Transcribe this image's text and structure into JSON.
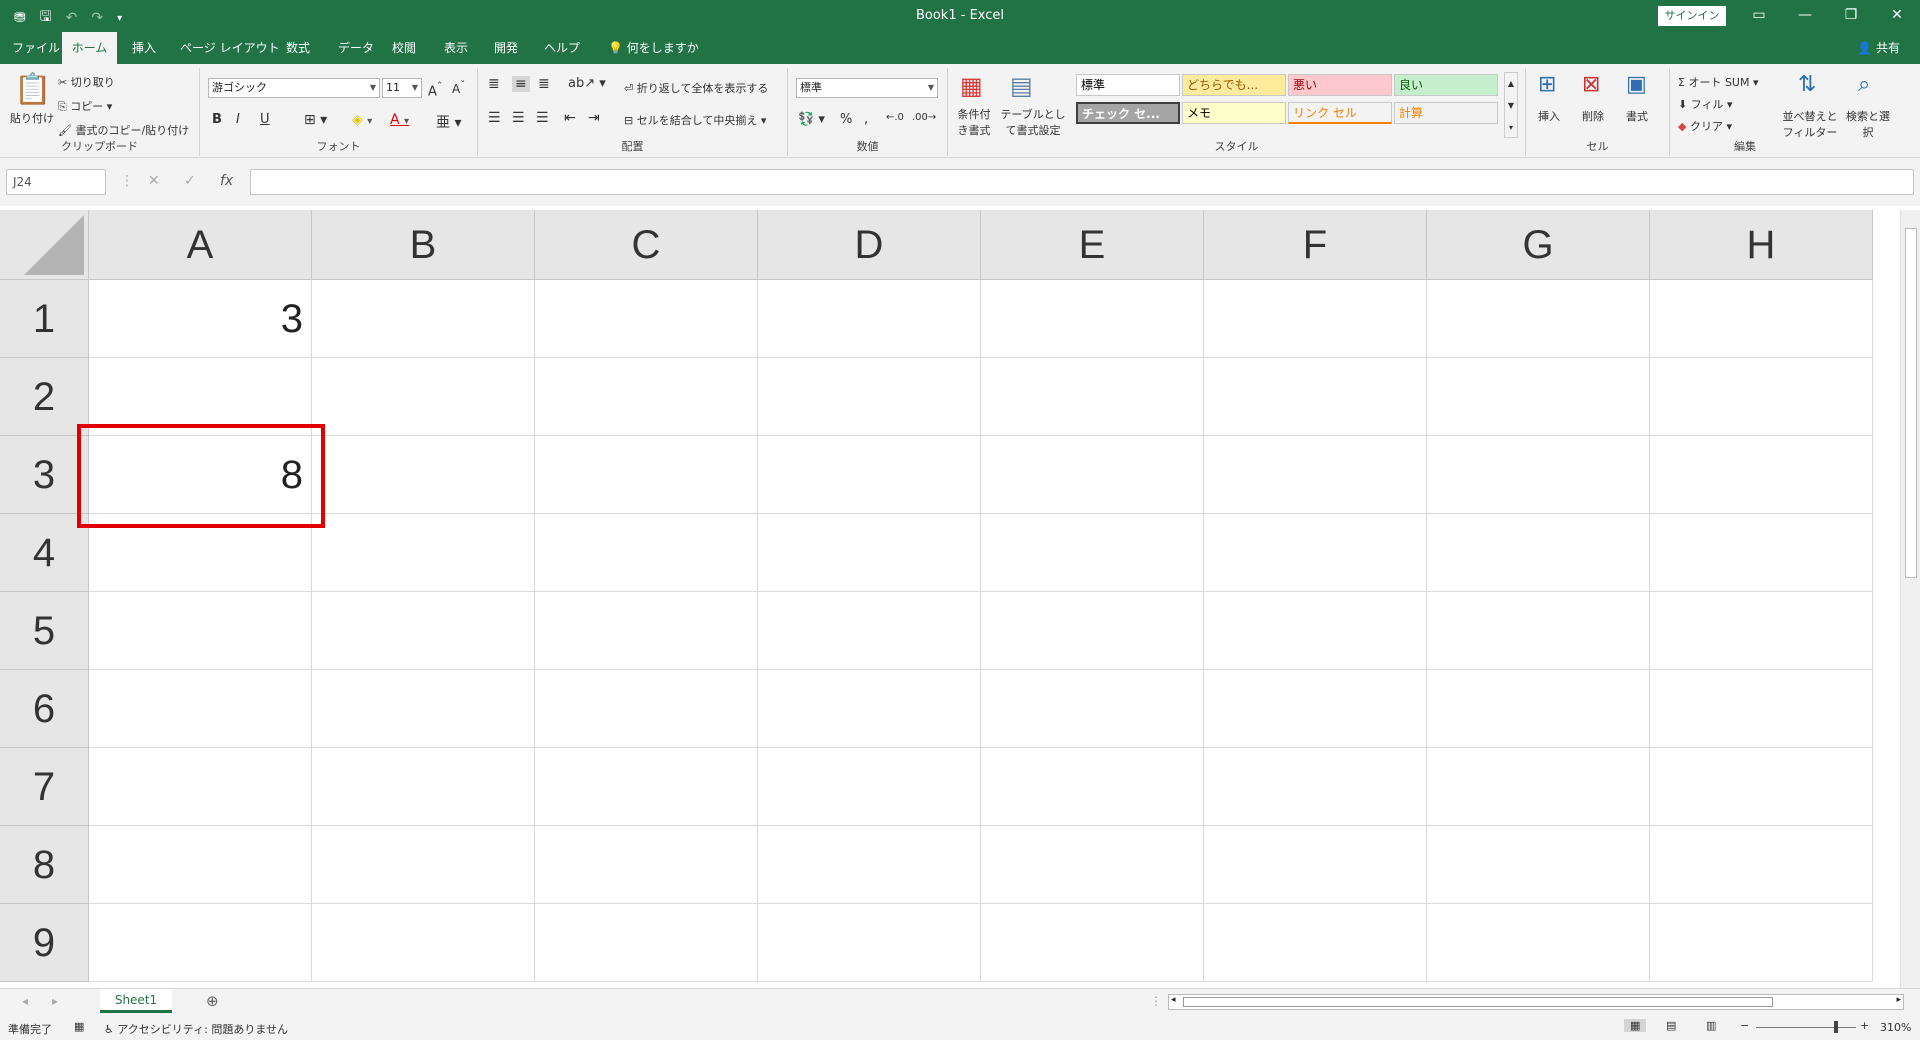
{
  "titlebar": {
    "title": "Book1  -  Excel",
    "signin": "サインイン",
    "accent": "#217346"
  },
  "tabs": [
    "ファイル",
    "ホーム",
    "挿入",
    "ページ レイアウト",
    "数式",
    "データ",
    "校閲",
    "表示",
    "開発",
    "ヘルプ",
    "何をしますか"
  ],
  "share_label": "共有",
  "ribbon": {
    "clipboard": {
      "label": "クリップボード",
      "paste": "貼り付け",
      "cut": "切り取り",
      "copy": "コピー",
      "format_painter": "書式のコピー/貼り付け"
    },
    "font": {
      "label": "フォント",
      "font_name": "游ゴシック",
      "font_size": "11",
      "bold": "B",
      "italic": "I",
      "underline": "U"
    },
    "alignment": {
      "label": "配置",
      "wrap_text": "折り返して全体を表示する",
      "merge_center": "セルを結合して中央揃え"
    },
    "number": {
      "label": "数値",
      "format": "標準",
      "percent": "%"
    },
    "styles": {
      "label": "スタイル",
      "conditional": "条件付き書式",
      "table": "テーブルとして書式設定",
      "cells": [
        {
          "name": "標準",
          "bg": "#ffffff",
          "fg": "#000000"
        },
        {
          "name": "どちらでも...",
          "bg": "#ffeb9c",
          "fg": "#9c5700"
        },
        {
          "name": "悪い",
          "bg": "#ffc7ce",
          "fg": "#9c0006"
        },
        {
          "name": "良い",
          "bg": "#c6efce",
          "fg": "#006100"
        },
        {
          "name": "チェック セ...",
          "bg": "#a5a5a5",
          "fg": "#ffffff"
        },
        {
          "name": "メモ",
          "bg": "#ffffcc",
          "fg": "#000000"
        },
        {
          "name": "リンク セル",
          "bg": "#f3f3f3",
          "fg": "#fa7d00"
        },
        {
          "name": "計算",
          "bg": "#f2f2f2",
          "fg": "#fa7d00"
        }
      ]
    },
    "cells_group": {
      "label": "セル",
      "insert": "挿入",
      "delete": "削除",
      "format": "書式"
    },
    "editing": {
      "label": "編集",
      "autosum": "オート SUM",
      "fill": "フィル",
      "clear": "クリア",
      "sort_filter": "並べ替えとフィルター",
      "find_select": "検索と選択"
    }
  },
  "formula_bar": {
    "name_box": "J24",
    "fx": "fx",
    "value": ""
  },
  "columns": [
    "A",
    "B",
    "C",
    "D",
    "E",
    "F",
    "G",
    "H"
  ],
  "rows": [
    "1",
    "2",
    "3",
    "4",
    "5",
    "6",
    "7",
    "8",
    "9"
  ],
  "cells": {
    "A1": "3",
    "A3": "8"
  },
  "highlight_cell": "A3",
  "sheets": [
    "Sheet1"
  ],
  "status": {
    "ready": "準備完了",
    "accessibility": "アクセシビリティ: 問題ありません",
    "zoom": "310%"
  }
}
